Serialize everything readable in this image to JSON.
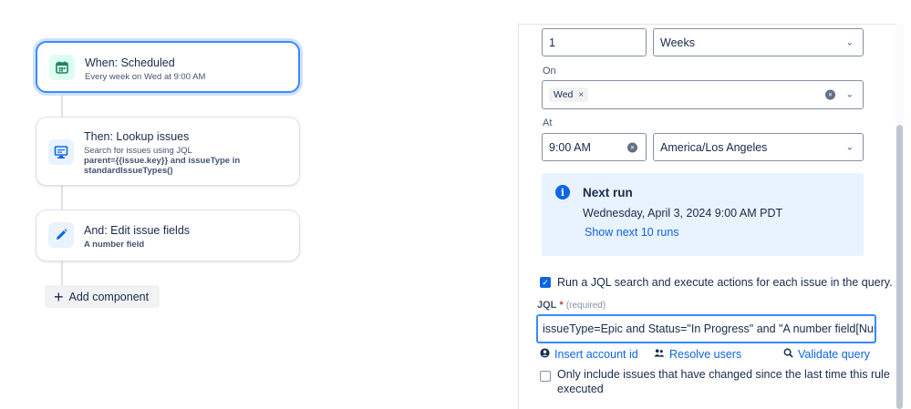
{
  "flow": {
    "trigger": {
      "title": "When: Scheduled",
      "sub": "Every week on Wed at 9:00 AM"
    },
    "lookup": {
      "title": "Then: Lookup issues",
      "sub1": "Search for issues using JQL",
      "sub2": "parent={{issue.key}} and issueType in",
      "sub3": "standardIssueTypes()"
    },
    "edit": {
      "title": "And: Edit issue fields",
      "sub": "A number field"
    },
    "add_label": "Add component"
  },
  "schedule": {
    "interval_value": "1",
    "interval_unit": "Weeks",
    "on_label": "On",
    "on_tag": "Wed",
    "at_label": "At",
    "time_value": "9:00 AM",
    "timezone": "America/Los Angeles"
  },
  "next_run": {
    "heading": "Next run",
    "datetime": "Wednesday, April 3, 2024 9:00 AM PDT",
    "show_more": "Show next 10 runs"
  },
  "jql": {
    "run_jql_text": "Run a JQL search and execute actions for each issue in the query.",
    "label": "JQL",
    "required_star": "*",
    "required_hint": "(required)",
    "value": "issueType=Epic and Status=\"In Progress\" and \"A number field[Number",
    "insert_account": "Insert account id",
    "resolve_users": "Resolve users",
    "validate": "Validate query",
    "only_changed_line1": "Only include issues that have changed since the last time this rule",
    "only_changed_line2": "executed"
  },
  "colors": {
    "accent": "#0c66e4",
    "selected_border": "#388bff",
    "info_bg": "#e9f2ff"
  }
}
